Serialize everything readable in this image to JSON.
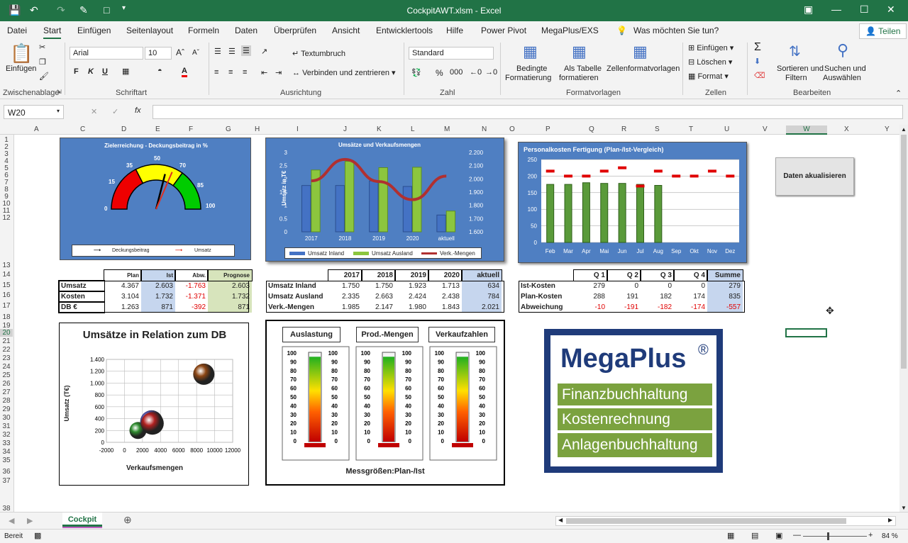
{
  "titlebar": {
    "title": "CockpitAWT.xlsm  -  Excel"
  },
  "tabs": [
    "Datei",
    "Start",
    "Einfügen",
    "Seitenlayout",
    "Formeln",
    "Daten",
    "Überprüfen",
    "Ansicht",
    "Entwicklertools",
    "Hilfe",
    "Power Pivot",
    "MegaPlus/EXS"
  ],
  "search_placeholder": "Was möchten Sie tun?",
  "share": "Teilen",
  "ribbon": {
    "paste": "Einfügen",
    "font_name": "Arial",
    "font_size": "10",
    "wrap": "Textumbruch",
    "merge": "Verbinden und zentrieren",
    "number_format": "Standard",
    "cond1": "Bedingte",
    "cond2": "Formatierung",
    "table1": "Als Tabelle",
    "table2": "formatieren",
    "cellstyles": "Zellenformatvorlagen",
    "insert": "Einfügen",
    "delete": "Löschen",
    "format": "Format",
    "sort1": "Sortieren und",
    "sort2": "Filtern",
    "find1": "Suchen und",
    "find2": "Auswählen",
    "groups": {
      "clip": "Zwischenablage",
      "font": "Schriftart",
      "align": "Ausrichtung",
      "num": "Zahl",
      "styles": "Formatvorlagen",
      "cells": "Zellen",
      "edit": "Bearbeiten"
    }
  },
  "namebox": "W20",
  "columns": [
    "A",
    "C",
    "D",
    "E",
    "F",
    "G",
    "H",
    "I",
    "J",
    "K",
    "L",
    "M",
    "N",
    "O",
    "P",
    "Q",
    "R",
    "S",
    "T",
    "U",
    "V",
    "W",
    "X",
    "Y"
  ],
  "rows": [
    "1",
    "2",
    "3",
    "4",
    "5",
    "6",
    "7",
    "8",
    "9",
    "10",
    "11",
    "12",
    "13",
    "14",
    "15",
    "16",
    "17",
    "18",
    "19",
    "20",
    "21",
    "22",
    "23",
    "24",
    "25",
    "26",
    "27",
    "28",
    "29",
    "30",
    "31",
    "32",
    "33",
    "34",
    "35",
    "36",
    "37",
    "38"
  ],
  "gauge": {
    "title": "Zielerreichung - Deckungsbeitrag in %",
    "ticks": [
      "0",
      "15",
      "35",
      "50",
      "70",
      "85",
      "100"
    ],
    "legend": [
      "Deckungsbeitrag",
      "Umsatz"
    ],
    "db_value": 58,
    "umsatz_value": 63
  },
  "chart_data": [
    {
      "type": "bar",
      "title": "Umsätze und Verkaufsmengen",
      "ylabel": "Umsatz in T€",
      "categories": [
        "2017",
        "2018",
        "2019",
        "2020",
        "aktuell"
      ],
      "ylim": [
        0,
        3
      ],
      "y2lim": [
        1600,
        2200
      ],
      "yticks": [
        "0",
        "0.5",
        "1",
        "1.5",
        "2",
        "2.5",
        "3"
      ],
      "y2ticks": [
        "1.600",
        "1.700",
        "1.800",
        "1.900",
        "2.000",
        "2.100",
        "2.200"
      ],
      "series": [
        {
          "name": "Umsatz Inland",
          "values": [
            1.75,
            1.75,
            1.923,
            1.713,
            0.634
          ]
        },
        {
          "name": "Umsatz Ausland",
          "values": [
            2.335,
            2.663,
            2.424,
            2.438,
            0.784
          ]
        },
        {
          "name": "Verk.-Mengen",
          "axis": "secondary",
          "values": [
            1985,
            2147,
            1980,
            1843,
            2021
          ]
        }
      ]
    },
    {
      "type": "bar",
      "title": "Personalkosten Fertigung (Plan-/Ist-Vergleich)",
      "categories": [
        "Feb",
        "Mar",
        "Apr",
        "Mai",
        "Jun",
        "Jul",
        "Aug",
        "Sep",
        "Okt",
        "Nov",
        "Dez"
      ],
      "ylim": [
        0,
        250
      ],
      "yticks": [
        "0",
        "50",
        "100",
        "150",
        "200",
        "250"
      ],
      "series": [
        {
          "name": "Ist",
          "values": [
            175,
            175,
            180,
            178,
            178,
            175,
            172,
            null,
            null,
            null,
            null
          ]
        },
        {
          "name": "Plan",
          "values": [
            215,
            200,
            200,
            215,
            225,
            170,
            215,
            200,
            200,
            215,
            200
          ]
        }
      ]
    },
    {
      "type": "scatter",
      "title": "Umsätze in Relation zum DB",
      "xlabel": "Verkaufsmengen",
      "ylabel": "Umsatz (T€)",
      "xlim": [
        -2000,
        12000
      ],
      "ylim": [
        0,
        1400
      ],
      "xticks": [
        "-2000",
        "0",
        "2000",
        "4000",
        "6000",
        "8000",
        "10000",
        "12000"
      ],
      "yticks": [
        "0",
        "200",
        "400",
        "600",
        "800",
        "1.000",
        "1.200",
        "1.400"
      ],
      "series": [
        {
          "points": [
            {
              "x": 1500,
              "y": 200,
              "r": 12,
              "color": "#2e8b2e"
            },
            {
              "x": 3000,
              "y": 350,
              "r": 16,
              "color": "#5050a0"
            },
            {
              "x": 3100,
              "y": 320,
              "r": 16,
              "color": "#b02020"
            },
            {
              "x": 8800,
              "y": 1150,
              "r": 15,
              "color": "#8b4513"
            }
          ]
        }
      ]
    }
  ],
  "table1": {
    "headers": [
      "",
      "Plan",
      "Ist",
      "Abw.",
      "Prognose"
    ],
    "rows": [
      [
        "Umsatz",
        "4.367",
        "2.603",
        "-1.763",
        "2.603"
      ],
      [
        "Kosten",
        "3.104",
        "1.732",
        "-1.371",
        "1.732"
      ],
      [
        "DB €",
        "1.263",
        "871",
        "-392",
        "871"
      ]
    ]
  },
  "table2": {
    "headers": [
      "",
      "2017",
      "2018",
      "2019",
      "2020",
      "aktuell"
    ],
    "rows": [
      [
        "Umsatz Inland",
        "1.750",
        "1.750",
        "1.923",
        "1.713",
        "634"
      ],
      [
        "Umsatz Ausland",
        "2.335",
        "2.663",
        "2.424",
        "2.438",
        "784"
      ],
      [
        "Verk.-Mengen",
        "1.985",
        "2.147",
        "1.980",
        "1.843",
        "2.021"
      ]
    ]
  },
  "table3": {
    "headers": [
      "",
      "Q 1",
      "Q 2",
      "Q 3",
      "Q 4",
      "Summe"
    ],
    "rows": [
      [
        "Ist-Kosten",
        "279",
        "0",
        "0",
        "0",
        "279"
      ],
      [
        "Plan-Kosten",
        "288",
        "191",
        "182",
        "174",
        "835"
      ],
      [
        "Abweichung",
        "-10",
        "-191",
        "-182",
        "-174",
        "-557"
      ]
    ]
  },
  "thermo": {
    "buttons": [
      "Auslastung",
      "Prod.-Mengen",
      "Verkaufzahlen"
    ],
    "ticks": [
      "100",
      "90",
      "80",
      "70",
      "60",
      "50",
      "40",
      "30",
      "20",
      "10",
      "0"
    ],
    "footer": "Messgrößen:Plan-/Ist",
    "levels": [
      0.95,
      0.95,
      0.95
    ]
  },
  "button_update": "Daten akualisieren",
  "logo": {
    "name": "MegaPlus",
    "reg": "®",
    "items": [
      "Finanzbuchhaltung",
      "Kostenrechnung",
      "Anlagenbuchhaltung"
    ]
  },
  "sheet_tab": "Cockpit",
  "status": {
    "ready": "Bereit",
    "zoom": "84 %"
  }
}
